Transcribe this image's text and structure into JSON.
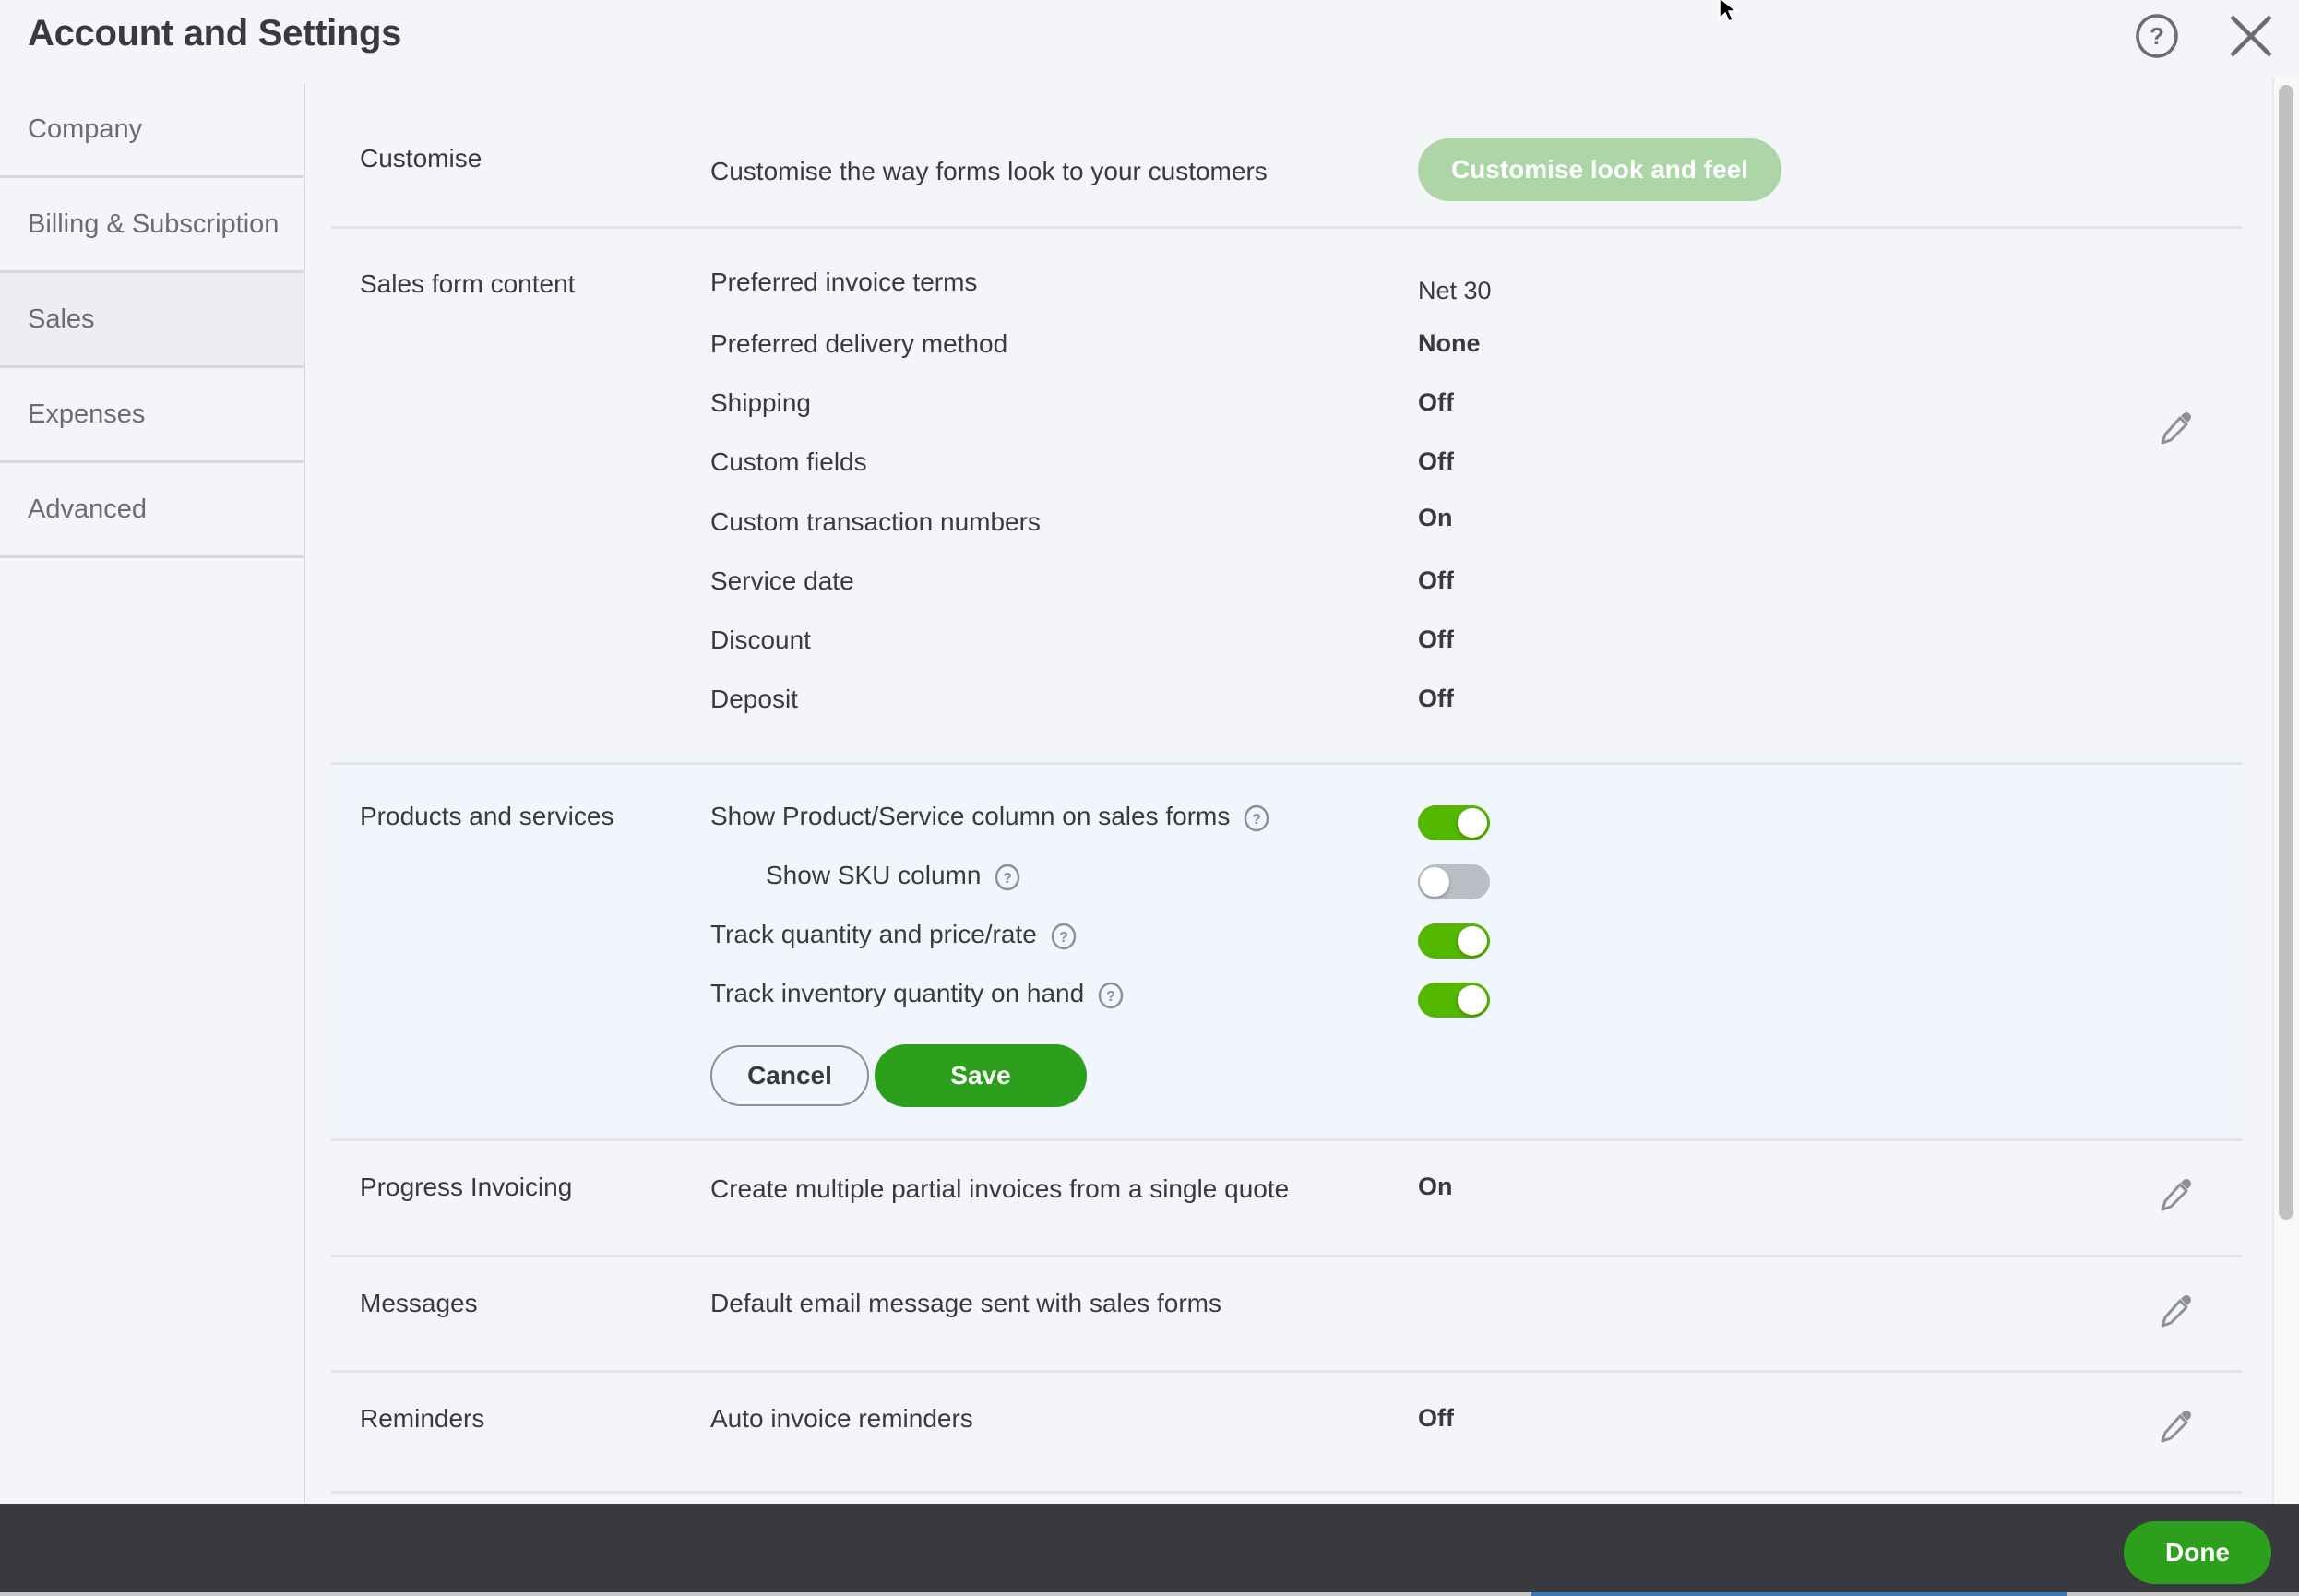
{
  "header": {
    "title": "Account and Settings",
    "help_icon": "help-circle-icon",
    "close_icon": "close-x-icon"
  },
  "sidebar": {
    "items": [
      {
        "label": "Company",
        "active": false
      },
      {
        "label": "Billing & Subscription",
        "active": false
      },
      {
        "label": "Sales",
        "active": true
      },
      {
        "label": "Expenses",
        "active": false
      },
      {
        "label": "Advanced",
        "active": false
      }
    ]
  },
  "sections": {
    "customise": {
      "label": "Customise",
      "description": "Customise the way forms look to your customers",
      "button_label": "Customise look and feel"
    },
    "sales_form_content": {
      "label": "Sales form content",
      "rows": [
        {
          "label": "Preferred invoice terms",
          "value": "Net 30"
        },
        {
          "label": "Preferred delivery method",
          "value": "None"
        },
        {
          "label": "Shipping",
          "value": "Off"
        },
        {
          "label": "Custom fields",
          "value": "Off"
        },
        {
          "label": "Custom transaction numbers",
          "value": "On"
        },
        {
          "label": "Service date",
          "value": "Off"
        },
        {
          "label": "Discount",
          "value": "Off"
        },
        {
          "label": "Deposit",
          "value": "Off"
        }
      ]
    },
    "products_and_services": {
      "label": "Products and services",
      "rows": [
        {
          "label": "Show Product/Service column on sales forms",
          "enabled": true,
          "has_help": true
        },
        {
          "label": "Show SKU column",
          "enabled": false,
          "has_help": true
        },
        {
          "label": "Track quantity and price/rate",
          "enabled": true,
          "has_help": true
        },
        {
          "label": "Track inventory quantity on hand",
          "enabled": true,
          "has_help": true
        }
      ],
      "cancel_label": "Cancel",
      "save_label": "Save"
    },
    "progress_invoicing": {
      "label": "Progress Invoicing",
      "description": "Create multiple partial invoices from a single quote",
      "value": "On"
    },
    "messages": {
      "label": "Messages",
      "description": "Default email message sent with sales forms"
    },
    "reminders": {
      "label": "Reminders",
      "description": "Auto invoice reminders",
      "value": "Off"
    }
  },
  "footer": {
    "done_label": "Done"
  },
  "colors": {
    "primary_green": "#2ca01c",
    "toggle_on": "#53b700",
    "toggle_off": "#babec5",
    "disabled_green": "#acd5a8",
    "footer_bg": "#393a3d",
    "page_bg": "#f4f5f8",
    "editing_section_bg": "#f1f6fd"
  }
}
